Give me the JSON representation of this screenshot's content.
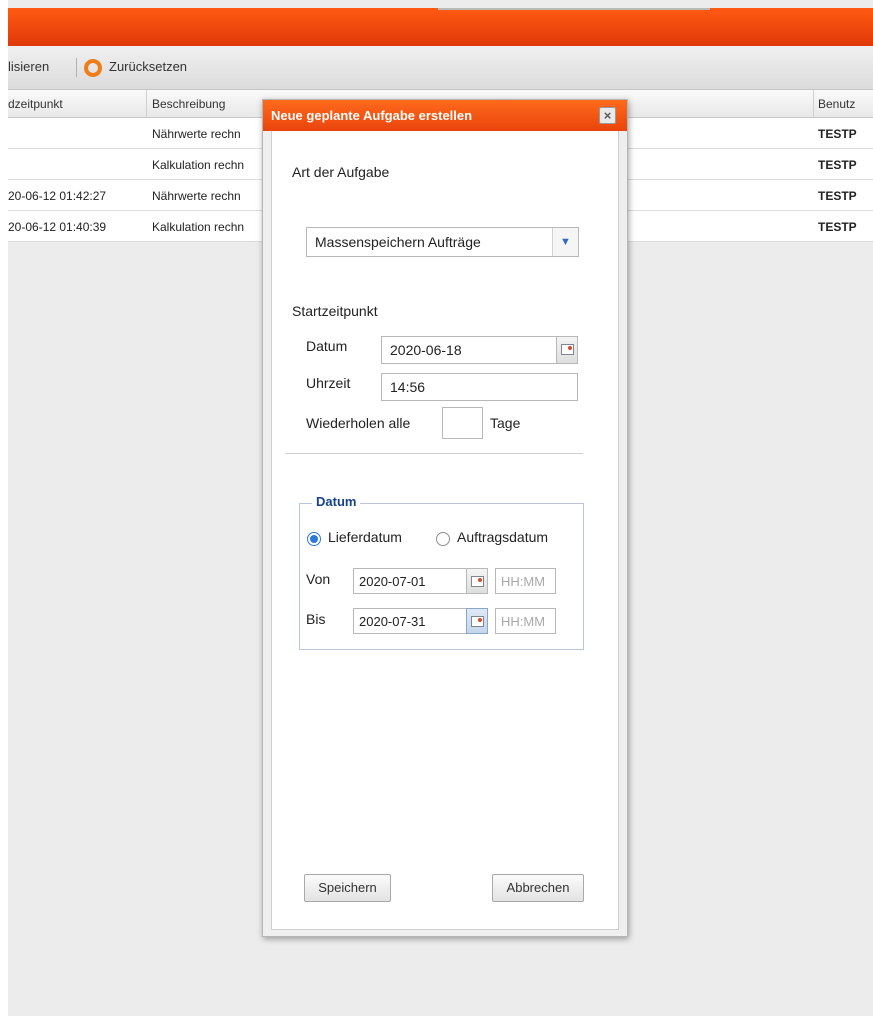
{
  "toolbar": {
    "refresh_label": "lisieren",
    "reset_label": "Zurücksetzen"
  },
  "grid": {
    "columns": [
      "dzeitpunkt",
      "Beschreibung",
      "Benutz"
    ],
    "rows": [
      {
        "time": "",
        "desc": "Nährwerte rechn",
        "user": "TESTP"
      },
      {
        "time": "",
        "desc": "Kalkulation rechn",
        "user": "TESTP"
      },
      {
        "time": "20-06-12 01:42:27",
        "desc": "Nährwerte rechn",
        "user": "TESTP"
      },
      {
        "time": "20-06-12 01:40:39",
        "desc": "Kalkulation rechn",
        "user": "TESTP"
      }
    ]
  },
  "dialog": {
    "title": "Neue geplante Aufgabe erstellen",
    "close_symbol": "×",
    "task_type_label": "Art der Aufgabe",
    "task_type_value": "Massenspeichern Aufträge",
    "start_label": "Startzeitpunkt",
    "date_label": "Datum",
    "date_value": "2020-06-18",
    "time_label": "Uhrzeit",
    "time_value": "14:56",
    "repeat_label": "Wiederholen alle",
    "repeat_value": "",
    "repeat_unit": "Tage",
    "fieldset_legend": "Datum",
    "radio_delivery": "Lieferdatum",
    "radio_order": "Auftragsdatum",
    "radio_selected": "Lieferdatum",
    "from_label": "Von",
    "from_date": "2020-07-01",
    "from_time_placeholder": "HH:MM",
    "to_label": "Bis",
    "to_date": "2020-07-31",
    "to_time_placeholder": "HH:MM",
    "save_label": "Speichern",
    "cancel_label": "Abbrechen"
  },
  "icons": {
    "reset": "reset-icon",
    "close": "close-icon",
    "dropdown": "chevron-down-icon",
    "calendar": "calendar-icon"
  },
  "colors": {
    "header_orange": "#e9440c",
    "reset_icon": "#f07d18",
    "legend_blue": "#15428b",
    "radio_blue": "#2d79d6"
  }
}
